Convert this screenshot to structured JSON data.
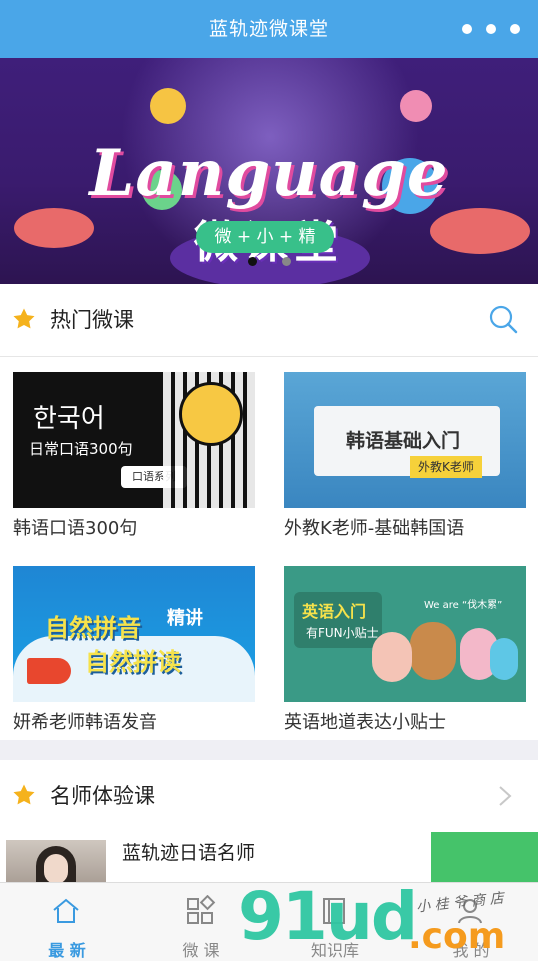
{
  "app": {
    "title": "蓝轨迹微课堂"
  },
  "banner": {
    "headline": "Language",
    "subtitle": "微课堂",
    "pill": "微 + 小 + 精",
    "active_dot": 1,
    "dot_count": 2
  },
  "hot": {
    "title": "热门微课",
    "items": [
      {
        "caption": "韩语口语300句",
        "thumb_text": "한국어",
        "thumb_sub": "日常口语300句",
        "thumb_tag": "口语系列"
      },
      {
        "caption": "外教K老师-基础韩国语",
        "thumb_text": "韩语基础入门",
        "thumb_sub": "外教K老师"
      },
      {
        "caption": "妍希老师韩语发音",
        "thumb_text": "自然拼音",
        "thumb_sub": "自然拼读",
        "thumb_tag": "精讲"
      },
      {
        "caption": "英语地道表达小贴士",
        "thumb_text": "英语入门",
        "thumb_sub": "有FUN小贴士",
        "thumb_tag": "We are “伐木累”"
      }
    ]
  },
  "teachers": {
    "title": "名师体验课",
    "first_name": "蓝轨迹日语名师"
  },
  "tabs": [
    {
      "label": "最 新",
      "icon": "home-icon",
      "active": true
    },
    {
      "label": "微 课",
      "icon": "grid-icon",
      "active": false
    },
    {
      "label": "知识库",
      "icon": "book-icon",
      "active": false
    },
    {
      "label": "我 的",
      "icon": "user-icon",
      "active": false
    }
  ],
  "watermark": {
    "big": "91ud",
    "com": ".com",
    "hand": "小 桂 爷 商 店"
  },
  "colors": {
    "brand": "#4aa6e8",
    "star": "#f5b21c",
    "green": "#45c36a",
    "active_tab": "#3a9ae0"
  }
}
